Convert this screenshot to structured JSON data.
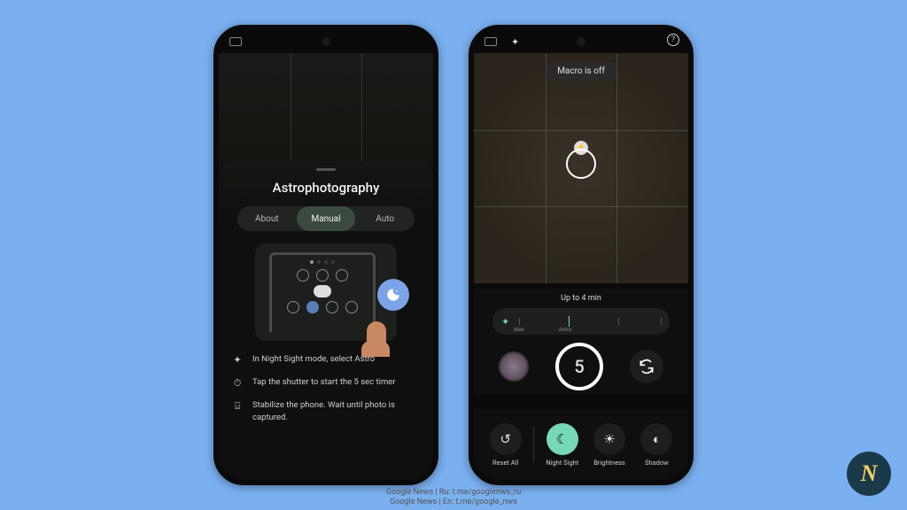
{
  "phone1": {
    "sheet_title": "Astrophotography",
    "tabs": {
      "about": "About",
      "manual": "Manual",
      "auto": "Auto"
    },
    "tips": [
      {
        "icon": "✦",
        "text": "In Night Sight mode, select Astro"
      },
      {
        "icon": "⏱",
        "text": "Tap the shutter to start the 5 sec timer"
      },
      {
        "icon": "⌸",
        "text": "Stabilize the phone. Wait until photo is captured."
      }
    ]
  },
  "phone2": {
    "toast": "Macro is off",
    "exposure_label": "Up to 4 min",
    "slider": {
      "min_label": "Max",
      "max_label": "Astro"
    },
    "shutter_text": "5",
    "bottom_tabs": [
      {
        "label": "Reset All",
        "glyph": "↺",
        "active": false
      },
      {
        "label": "Night Sight",
        "glyph": "☾",
        "active": true
      },
      {
        "label": "Brightness",
        "glyph": "☀",
        "active": false
      },
      {
        "label": "Shadow",
        "glyph": "◐",
        "active": false
      }
    ]
  },
  "footer": {
    "line1": "Google News | Ru: t.me/googlenws_ru",
    "line2": "Google News | En: t.me/google_nws"
  },
  "logo": "N"
}
